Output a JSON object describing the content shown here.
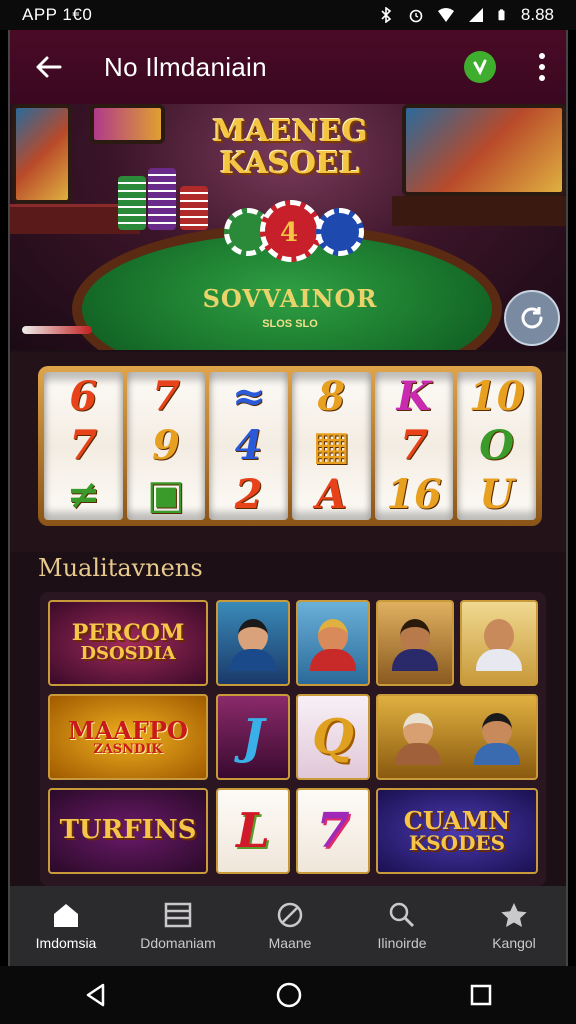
{
  "status_bar": {
    "left_text": "APP 1€0",
    "time": "8.88",
    "icons": [
      "bluetooth-icon",
      "alarm-icon",
      "wifi-icon",
      "signal-icon",
      "battery-icon"
    ]
  },
  "app_bar": {
    "title": "No Ilmdaniain",
    "back_icon": "arrow-left-icon",
    "verified_icon": "verified-check-icon",
    "menu_icon": "more-vertical-icon"
  },
  "hero": {
    "title_line1": "MAENEG",
    "title_line2": "KASOEL",
    "felt_title": "SOVVAINOR",
    "felt_subtitle": "SLOS SLO",
    "refresh_icon": "refresh-icon"
  },
  "reels": [
    {
      "symbols": [
        "6",
        "7",
        "≠"
      ]
    },
    {
      "symbols": [
        "7",
        "9",
        "▣"
      ]
    },
    {
      "symbols": [
        "≈",
        "4",
        "2"
      ]
    },
    {
      "symbols": [
        "8",
        "▦",
        "A"
      ]
    },
    {
      "symbols": [
        "K",
        "7",
        "16"
      ]
    },
    {
      "symbols": [
        "10",
        "O",
        "U"
      ]
    }
  ],
  "section": {
    "title": "Mualitavnens"
  },
  "tiles": {
    "percom": {
      "line1": "PERCOM",
      "line2": "DSOSDIA"
    },
    "mafpo": {
      "line1": "MAAFPO",
      "line2": "ZASNDIK"
    },
    "turfins": {
      "line1": "TURFINS"
    },
    "cuamn": {
      "line1": "CUAMN",
      "line2": "KSODES"
    },
    "card_j": "J",
    "card_q": "Q",
    "card_l": "L",
    "card_7": "7"
  },
  "bottom_nav": [
    {
      "label": "Imdomsia",
      "icon": "home-icon",
      "active": true
    },
    {
      "label": "Ddomaniam",
      "icon": "list-icon",
      "active": false
    },
    {
      "label": "Maane",
      "icon": "no-entry-icon",
      "active": false
    },
    {
      "label": "Ilinoirde",
      "icon": "search-icon",
      "active": false
    },
    {
      "label": "Kangol",
      "icon": "star-icon",
      "active": false
    }
  ],
  "system_nav": [
    "back-triangle-icon",
    "home-circle-icon",
    "recents-square-icon"
  ],
  "colors": {
    "appbar": "#4a0a26",
    "felt": "#1f8a35",
    "gold": "#f4c542",
    "nav_bg": "#2b2b2e"
  }
}
